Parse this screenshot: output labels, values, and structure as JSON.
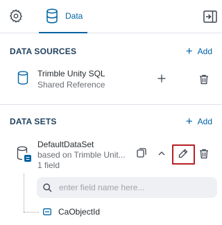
{
  "tabs": {
    "settings_icon": "gear-icon",
    "data_label": "Data",
    "collapse_icon": "collapse-panel-icon"
  },
  "data_sources": {
    "title": "DATA SOURCES",
    "add_label": "Add",
    "items": [
      {
        "name": "Trimble Unity SQL",
        "subtitle": "Shared Reference"
      }
    ]
  },
  "data_sets": {
    "title": "DATA SETS",
    "add_label": "Add",
    "items": [
      {
        "name": "DefaultDataSet",
        "subtitle": "based on Trimble Unit...",
        "field_count": "1 field",
        "search_placeholder": "enter field name here...",
        "fields": [
          {
            "name": "CaObjectId"
          }
        ]
      }
    ]
  },
  "colors": {
    "accent": "#0063a3",
    "heading": "#1e3f5c",
    "highlight": "#b61f24"
  }
}
